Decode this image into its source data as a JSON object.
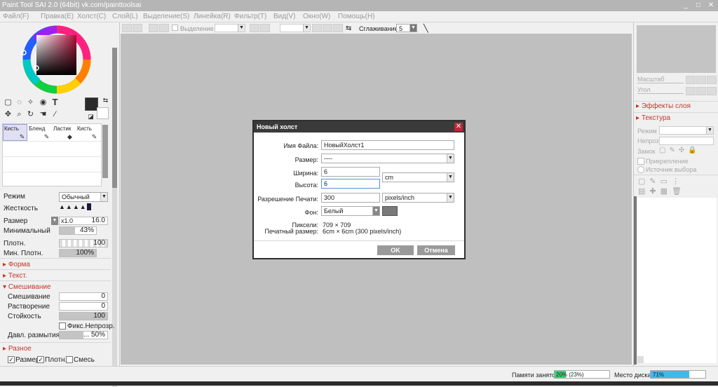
{
  "window": {
    "title": "Paint Tool SAI 2.0 (64bit) vk.com/painttoolsai",
    "minimize": "_",
    "maximize": "□",
    "close": "✕"
  },
  "menu": [
    "Файл(F)",
    "Правка(E)",
    "Холст(C)",
    "Слой(L)",
    "Выделение(S)",
    "Линейка(R)",
    "Фильтр(T)",
    "Вид(V)",
    "Окно(W)",
    "Помощь(H)"
  ],
  "toolbar": {
    "selection_label": "Выделение",
    "smoothing_label": "Сглаживание",
    "smoothing_value": "5"
  },
  "tools": {
    "brushes": [
      "Кисть",
      "Бленд",
      "Ластик",
      "Кисть"
    ]
  },
  "brush_settings": {
    "mode_label": "Режим",
    "mode_value": "Обычный",
    "hardness_label": "Жесткость",
    "size_label": "Размер",
    "size_multiplier": "x1.0",
    "size_value": "16.0",
    "min_label": "Минимальный",
    "min_value": "43%",
    "density_label": "Плотн.",
    "density_value": "100",
    "min_density_label": "Мин. Плотн.",
    "min_density_value": "100%",
    "form_section": "Форма",
    "text_section": "Текст.",
    "mixing_section": "Смешивание",
    "mixing_label": "Смешивание",
    "mixing_value": "0",
    "dilution_label": "Растворение",
    "dilution_value": "0",
    "persistence_label": "Стойкость",
    "persistence_value": "100",
    "fix_opacity_label": "Фикс.Непрозр.",
    "blur_label": "Давл. размытия",
    "blur_value": "... 50%",
    "misc_section": "Разное",
    "check_size": "Размер",
    "check_density": "Плотн.",
    "check_mix": "Смесь"
  },
  "right_panel": {
    "scale_label": "Масштаб",
    "angle_label": "Угол",
    "layer_effects": "Эффекты слоя",
    "texture": "Текстура",
    "mode_label": "Режим",
    "opacity_label": "Непроз.",
    "lock_label": "Замок",
    "clipping_label": "Прикрепление",
    "selection_source_label": "Источник выбора"
  },
  "status": {
    "memory_label": "Памяти занято",
    "memory_value": "20% (23%)",
    "memory_fraction": 0.2,
    "disk_label": "Место диска",
    "disk_value": "71%",
    "disk_fraction": 0.71
  },
  "dialog": {
    "title": "Новый холст",
    "close": "✕",
    "filename_label": "Имя Файла:",
    "filename_value": "НовыйХолст1",
    "size_label": "Размер:",
    "size_value": "----",
    "width_label": "Ширина:",
    "width_value": "6",
    "height_label": "Высота:",
    "height_value": "6",
    "unit_value": "cm",
    "resolution_label": "Разрешение Печати:",
    "resolution_value": "300",
    "resolution_unit": "pixels/inch",
    "background_label": "Фон:",
    "background_value": "Белый",
    "pixels_label": "Пиксели:",
    "pixels_value": "709 × 709",
    "print_size_label": "Печатный размер:",
    "print_size_value": "6cm × 6cm (300 pixels/inch)",
    "ok": "OK",
    "cancel": "Отмена"
  },
  "colors": {
    "accent_red": "#c0392b",
    "dialog_header": "#3a3a3a",
    "close_red": "#c0283a",
    "canvas_gray": "#bfbfbf",
    "status_green": "#3ad07a",
    "status_blue": "#3fb8f0"
  }
}
